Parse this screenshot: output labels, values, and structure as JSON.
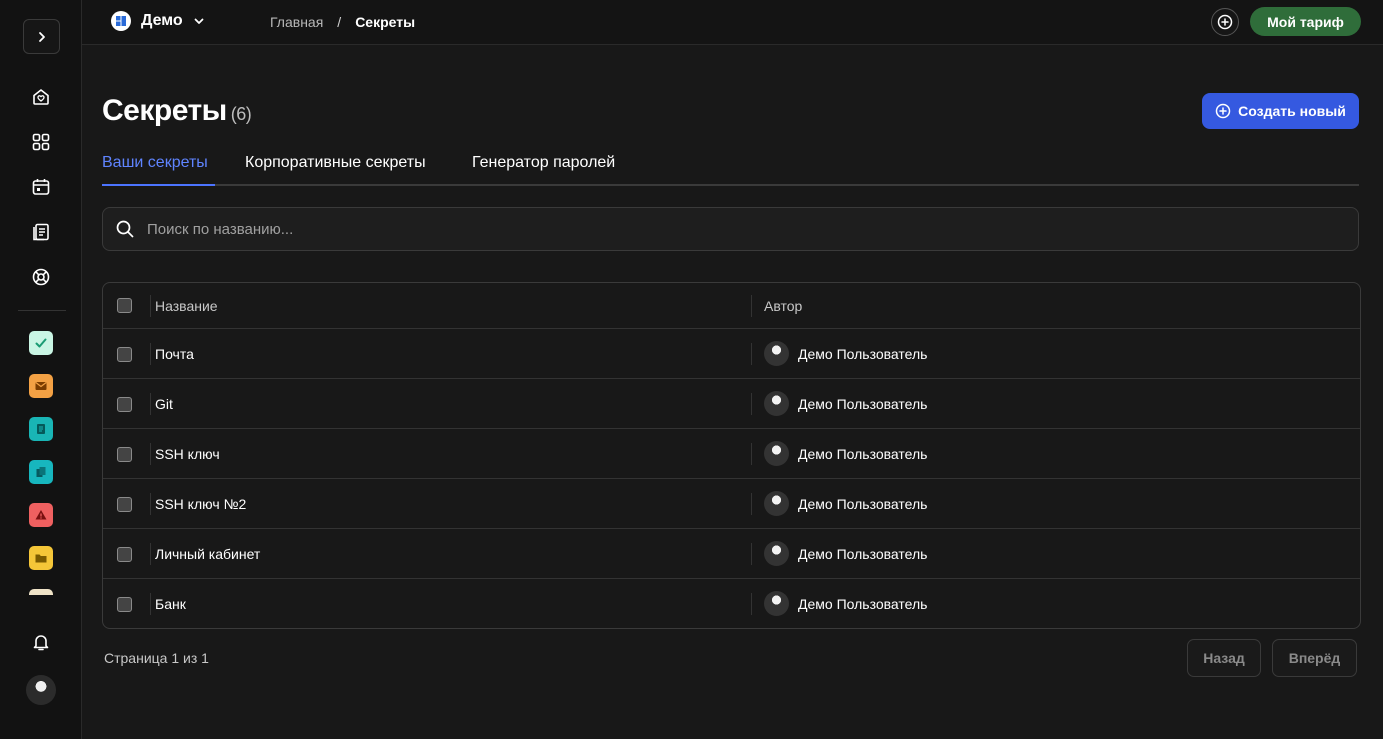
{
  "workspace": {
    "name": "Демо"
  },
  "breadcrumb": {
    "home": "Главная",
    "separator": "/",
    "current": "Секреты"
  },
  "header": {
    "plan_label": "Мой тариф"
  },
  "page": {
    "title": "Секреты",
    "count": "(6)",
    "create_label": "Создать новый"
  },
  "tabs": [
    {
      "label": "Ваши секреты",
      "active": true
    },
    {
      "label": "Корпоративные секреты",
      "active": false
    },
    {
      "label": "Генератор паролей",
      "active": false
    }
  ],
  "search": {
    "placeholder": "Поиск по названию...",
    "value": ""
  },
  "table": {
    "columns": {
      "name": "Название",
      "author": "Автор"
    },
    "rows": [
      {
        "name": "Почта",
        "author": "Демо Пользователь"
      },
      {
        "name": "Git",
        "author": "Демо Пользователь"
      },
      {
        "name": "SSH ключ",
        "author": "Демо Пользователь"
      },
      {
        "name": "SSH ключ №2",
        "author": "Демо Пользователь"
      },
      {
        "name": "Личный кабинет",
        "author": "Демо Пользователь"
      },
      {
        "name": "Банк",
        "author": "Демо Пользователь"
      }
    ]
  },
  "pagination": {
    "text": "Страница 1 из 1",
    "prev_label": "Назад",
    "next_label": "Вперёд"
  },
  "sidebar": {
    "nav_icons": [
      "home-icon",
      "apps-grid-icon",
      "calendar-icon",
      "documents-icon",
      "support-lifebuoy-icon"
    ],
    "app_tiles": [
      {
        "icon": "check-icon",
        "color": "#c9f5e4"
      },
      {
        "icon": "mail-icon",
        "color": "#f3a144"
      },
      {
        "icon": "notes-icon",
        "color": "#19b5b5"
      },
      {
        "icon": "files-icon",
        "color": "#17b6be"
      },
      {
        "icon": "alert-icon",
        "color": "#ef6060"
      },
      {
        "icon": "folder-icon",
        "color": "#f5c638"
      }
    ]
  },
  "colors": {
    "accent": "#3559e0",
    "plan_button": "#2f6d3a",
    "active_tab": "#5f84ff"
  }
}
